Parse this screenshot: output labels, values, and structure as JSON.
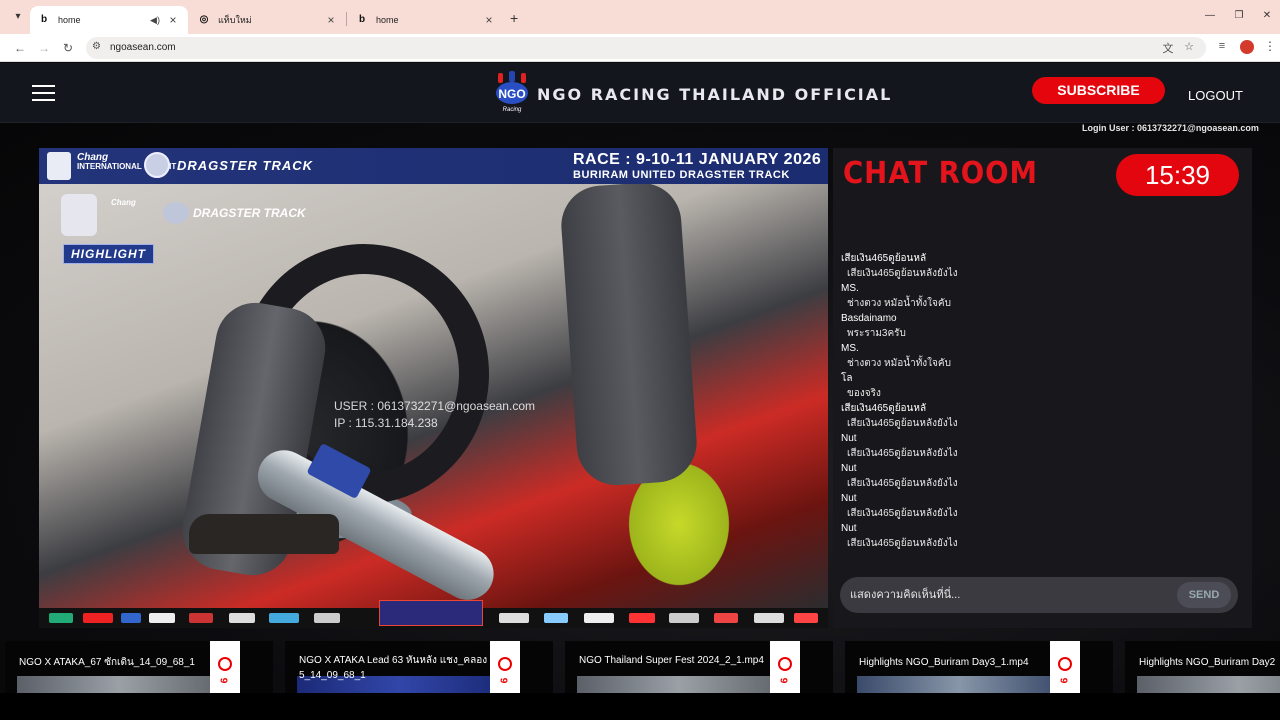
{
  "browser": {
    "tabs": [
      {
        "title": "home",
        "active": true,
        "audio": true
      },
      {
        "title": "แท็บใหม่",
        "active": false,
        "audio": false
      },
      {
        "title": "home",
        "active": false,
        "audio": false
      }
    ],
    "url": "ngoasean.com"
  },
  "header": {
    "title": "NGO RACING THAILAND OFFICIAL",
    "subscribe_label": "SUBSCRIBE",
    "logout_label": "LOGOUT",
    "login_user": "Login User : 0613732271@ngoasean.com"
  },
  "video": {
    "race_title": "RACE : 9-10-11 JANUARY 2026",
    "race_subtitle": "BURIRAM UNITED DRAGSTER TRACK",
    "circuit_label": "Chang",
    "circuit_sub": "INTERNATIONAL CIRCUIT",
    "track_logo": "DRAGSTER TRACK",
    "badge": "HIGHLIGHT",
    "watermark_user": "USER : 0613732271@ngoasean.com",
    "watermark_ip": "IP : 115.31.184.238"
  },
  "chat": {
    "title": "CHAT ROOM",
    "timer": "15:39",
    "messages": [
      {
        "user": "เสียเงิน465ดูย้อนหลั",
        "text": "เสียเงิน465ดูย้อนหลังยังไง"
      },
      {
        "user": "MS.",
        "text": "ช่างตวง หมัอน้ำทั้งใจคับ"
      },
      {
        "user": "Basdainamo",
        "text": "พระราม3ครับ"
      },
      {
        "user": "MS.",
        "text": "ช่างตวง หมัอน้ำทั้งใจคับ"
      },
      {
        "user": "โล",
        "text": "ของจริง"
      },
      {
        "user": "เสียเงิน465ดูย้อนหลั",
        "text": "เสียเงิน465ดูย้อนหลังยังไง"
      },
      {
        "user": "Nut",
        "text": "เสียเงิน465ดูย้อนหลังยังไง"
      },
      {
        "user": "Nut",
        "text": "เสียเงิน465ดูย้อนหลังยังไง"
      },
      {
        "user": "Nut",
        "text": "เสียเงิน465ดูย้อนหลังยังไง"
      },
      {
        "user": "Nut",
        "text": "เสียเงิน465ดูย้อนหลังยังไง"
      }
    ],
    "input_placeholder": "แสดงความคิดเห็นที่นี่...",
    "send_label": "SEND"
  },
  "playlist": [
    {
      "title": "NGO X ATAKA_67 ซักเดิน_14_09_68_1"
    },
    {
      "title": "NGO X ATAKA Lead 63 หันหลัง แชง_คลอง 5_14_09_68_1"
    },
    {
      "title": "NGO Thailand Super Fest 2024_2_1.mp4"
    },
    {
      "title": "Highlights NGO_Buriram Day3_1.mp4"
    },
    {
      "title": "Highlights NGO_Buriram Day2"
    }
  ],
  "colors": {
    "accent_red": "#e4050d",
    "header_bg": "#14161d",
    "video_banner": "#23347a"
  }
}
